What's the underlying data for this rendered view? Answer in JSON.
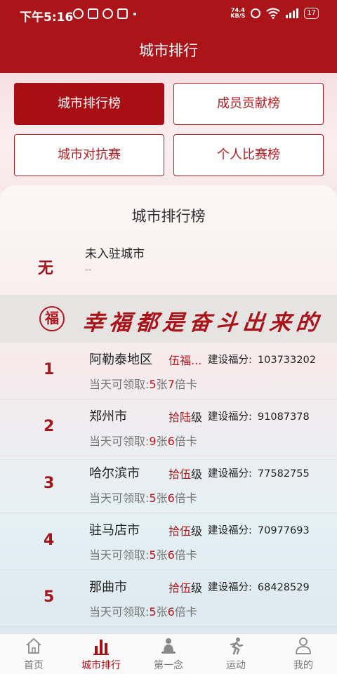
{
  "status_bar": {
    "time": "下午5:16",
    "net_speed_value": "74.4",
    "net_speed_unit": "KB/S",
    "battery": "17"
  },
  "header": {
    "title": "城市排行"
  },
  "tabs": [
    {
      "label": "城市排行榜",
      "active": true
    },
    {
      "label": "成员贡献榜",
      "active": false
    },
    {
      "label": "城市对抗赛",
      "active": false
    },
    {
      "label": "个人比赛榜",
      "active": false
    }
  ],
  "ranking": {
    "title": "城市排行榜",
    "my_city": {
      "rank": "无",
      "name": "未入驻城市",
      "sub": "--"
    },
    "banner": {
      "seal": "福",
      "text": "幸福都是奋斗出来的"
    },
    "points_label": "建设福分:",
    "claim_label": "当天可领取:",
    "rows": [
      {
        "rank": "1",
        "city": "阿勒泰地区",
        "level_num": "伍福...",
        "level_unit": "",
        "points": "103733202",
        "claim_count": "5",
        "claim_mid": "张",
        "claim_mult": "7",
        "claim_suffix": "倍卡"
      },
      {
        "rank": "2",
        "city": "郑州市",
        "level_num": "拾陆",
        "level_unit": "级",
        "points": "91087378",
        "claim_count": "9",
        "claim_mid": "张",
        "claim_mult": "6",
        "claim_suffix": "倍卡"
      },
      {
        "rank": "3",
        "city": "哈尔滨市",
        "level_num": "拾伍",
        "level_unit": "级",
        "points": "77582755",
        "claim_count": "5",
        "claim_mid": "张",
        "claim_mult": "6",
        "claim_suffix": "倍卡"
      },
      {
        "rank": "4",
        "city": "驻马店市",
        "level_num": "拾伍",
        "level_unit": "级",
        "points": "70977693",
        "claim_count": "5",
        "claim_mid": "张",
        "claim_mult": "6",
        "claim_suffix": "倍卡"
      },
      {
        "rank": "5",
        "city": "那曲市",
        "level_num": "拾伍",
        "level_unit": "级",
        "points": "68428529",
        "claim_count": "5",
        "claim_mid": "张",
        "claim_mult": "6",
        "claim_suffix": "倍卡"
      }
    ]
  },
  "bottom_nav": [
    {
      "label": "首页",
      "icon": "home-icon"
    },
    {
      "label": "城市排行",
      "icon": "bar-chart-icon",
      "active": true
    },
    {
      "label": "第一念",
      "icon": "meditation-icon"
    },
    {
      "label": "运动",
      "icon": "running-icon"
    },
    {
      "label": "我的",
      "icon": "user-icon"
    }
  ],
  "colors": {
    "brand_red": "#ab1519",
    "active_tab": "#a80f15",
    "rank_red": "#a3161b"
  }
}
